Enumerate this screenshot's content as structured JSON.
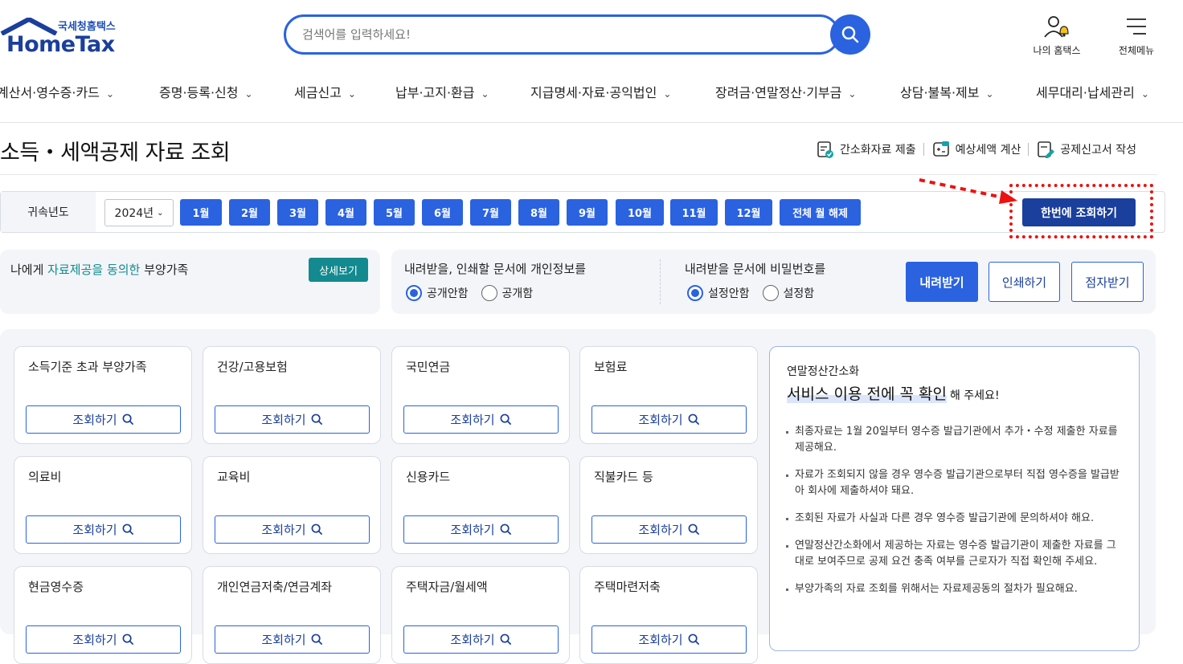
{
  "header": {
    "logo_sub": "국세청홈택스",
    "logo_main": "HomeTax",
    "search_placeholder": "검색어를 입력하세요!",
    "my_hometax": "나의 홈택스",
    "all_menu": "전체메뉴"
  },
  "nav": {
    "items": [
      "계산서·영수증·카드",
      "증명·등록·신청",
      "세금신고",
      "납부·고지·환급",
      "지급명세·자료·공익법인",
      "장려금·연말정산·기부금",
      "상담·불복·제보",
      "세무대리·납세관리"
    ]
  },
  "page": {
    "title": "소득・세액공제 자료 조회",
    "quick_links": [
      "간소화자료 제출",
      "예상세액 계산",
      "공제신고서 작성"
    ]
  },
  "filter": {
    "label": "귀속년도",
    "year": "2024년",
    "months": [
      "1월",
      "2월",
      "3월",
      "4월",
      "5월",
      "6월",
      "7월",
      "8월",
      "9월",
      "10월",
      "11월",
      "12월"
    ],
    "clear_all": "전체 월 해제",
    "lookup_all": "한번에 조회하기"
  },
  "consent": {
    "prefix": "나에게 ",
    "highlight": "자료제공을 동의한",
    "suffix": " 부양가족",
    "detail_button": "상세보기"
  },
  "options": {
    "personal_info_title": "내려받을, 인쇄할 문서에 개인정보를",
    "personal_info_options": [
      "공개안함",
      "공개함"
    ],
    "password_title": "내려받을 문서에 비밀번호를",
    "password_options": [
      "설정안함",
      "설정함"
    ],
    "download": "내려받기",
    "print": "인쇄하기",
    "braille": "점자받기"
  },
  "cards": {
    "lookup_label": "조회하기",
    "items": [
      "소득기준 초과 부양가족",
      "건강/고용보험",
      "국민연금",
      "보험료",
      "의료비",
      "교육비",
      "신용카드",
      "직불카드 등",
      "현금영수증",
      "개인연금저축/연금계좌",
      "주택자금/월세액",
      "주택마련저축"
    ]
  },
  "notice": {
    "subtitle": "연말정산간소화",
    "title_mark": "서비스 이용 전에 꼭 확인",
    "title_tail": "해 주세요!",
    "items": [
      "최종자료는 1월 20일부터 영수증 발급기관에서 추가・수정 제출한 자료를 제공해요.",
      "자료가 조회되지 않을 경우 영수증 발급기관으로부터 직접 영수증을 발급받아 회사에 제출하셔야 돼요.",
      "조회된 자료가 사실과 다른 경우 영수증 발급기관에 문의하셔야 해요.",
      "연말정산간소화에서 제공하는 자료는 영수증 발급기관이 제출한 자료를 그대로 보여주므로 공제 요건 충족 여부를 근로자가 직접 확인해 주세요.",
      "부양가족의 자료 조회를 위해서는 자료제공동의 절차가 필요해요."
    ]
  },
  "colors": {
    "primary": "#2a62e0",
    "navy": "#1a3f9c",
    "teal": "#138a8f",
    "annotation_red": "#e11111"
  }
}
